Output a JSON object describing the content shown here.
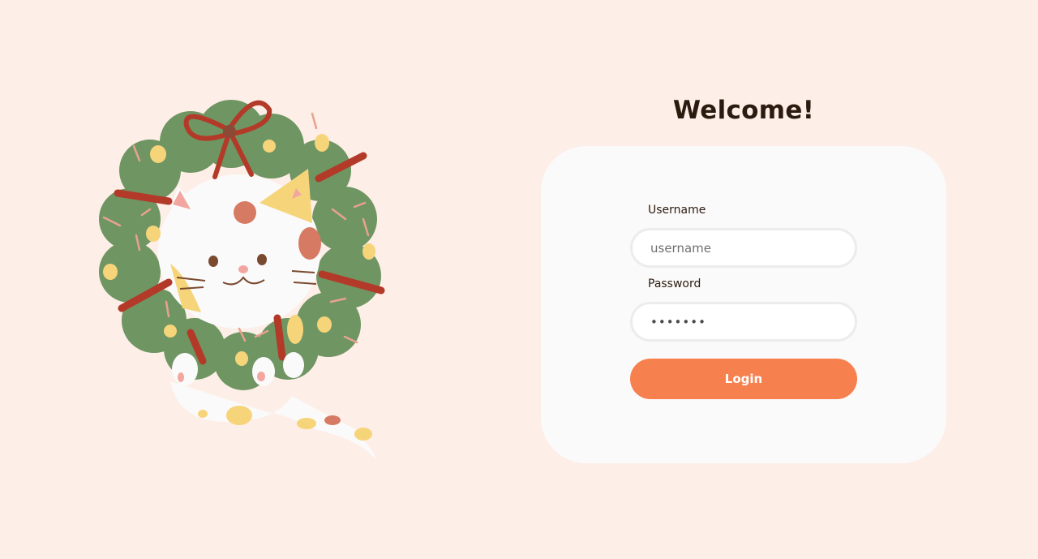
{
  "header": {
    "title": "Welcome!"
  },
  "login_form": {
    "username_label": "Username",
    "username_placeholder": "username",
    "username_value": "",
    "password_label": "Password",
    "password_value": "•••••••",
    "login_label": "Login"
  },
  "colors": {
    "background": "#fdeee7",
    "card": "#fbfafa",
    "accent": "#f6814f",
    "heading": "#2b1a0e"
  }
}
